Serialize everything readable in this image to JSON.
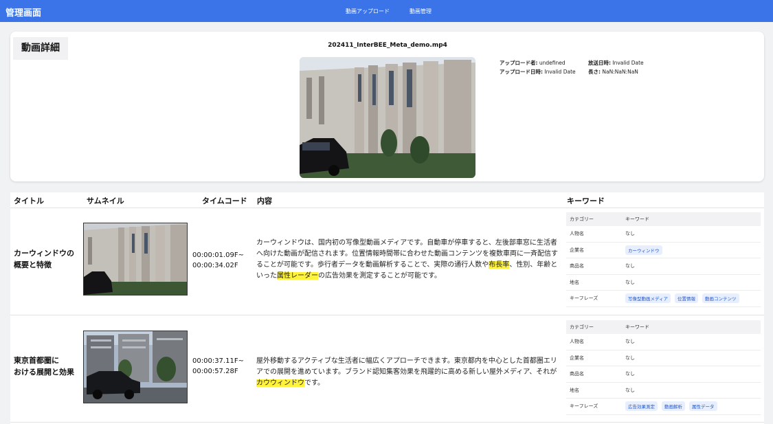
{
  "header": {
    "brand": "管理画面",
    "nav": [
      "動画アップロード",
      "動画管理"
    ],
    "color": "#3b73e8"
  },
  "detail": {
    "section_title": "動画詳細",
    "file_name": "202411_InterBEE_Meta_demo.mp4",
    "meta": {
      "uploader_label": "アップロード者:",
      "uploader_value": "undefined",
      "upload_date_label": "アップロード日時:",
      "upload_date_value": "Invalid Date",
      "broadcast_label": "放送日時:",
      "broadcast_value": "Invalid Date",
      "length_label": "長さ:",
      "length_value": "NaN:NaN:NaN"
    }
  },
  "table": {
    "headers": [
      "タイトル",
      "サムネイル",
      "タイムコード",
      "内容",
      "キーワード"
    ],
    "rows": [
      {
        "title_line1": "カーウィンドウの",
        "title_line2": "概要と特徴",
        "tc_start": "00:00:01.09F~",
        "tc_end": "00:00:34.02F",
        "content": {
          "before_1": "カーウィンドウは、国内初の写像型動画メディアです。自動車が停車すると、左後部車窓に生活者へ向けた動画が配信されます。位置情報時間帯に合わせた動画コンテンツを複数車両に一斉配信することが可能です。歩行者データを動画解析することで、実際の通行人数や",
          "hl_1": "布長率",
          "between": "、性別、年齢といった",
          "hl_2": "属性レーダー",
          "after": "の広告効果を測定することが可能です。"
        },
        "keywords": {
          "head_category": "カテゴリー",
          "head_keyword": "キーワード",
          "rows": [
            {
              "category": "人物名",
              "values": [
                "なし"
              ],
              "chips": false
            },
            {
              "category": "企業名",
              "values": [
                "カーウィンドウ"
              ],
              "chips": true
            },
            {
              "category": "商品名",
              "values": [
                "なし"
              ],
              "chips": false
            },
            {
              "category": "地名",
              "values": [
                "なし"
              ],
              "chips": false
            },
            {
              "category": "キーフレーズ",
              "values": [
                "写像型動画メディア",
                "位置情報",
                "動画コンテンツ"
              ],
              "chips": true
            }
          ]
        }
      },
      {
        "title_line1": "東京首都圏に",
        "title_line2": "おける展開と効果",
        "tc_start": "00:00:37.11F~",
        "tc_end": "00:00:57.28F",
        "content": {
          "before_1": "屋外移動するアクティブな生活者に幅広くアプローチできます。東京都内を中心とした首都圏エリアでの展開を進めています。ブランド認知集客効果を飛躍的に高める新しい屋外メディア、それが",
          "hl_1": "カウウィンドウ",
          "between": "です。",
          "hl_2": "",
          "after": ""
        },
        "keywords": {
          "head_category": "カテゴリー",
          "head_keyword": "キーワード",
          "rows": [
            {
              "category": "人物名",
              "values": [
                "なし"
              ],
              "chips": false
            },
            {
              "category": "企業名",
              "values": [
                "なし"
              ],
              "chips": false
            },
            {
              "category": "商品名",
              "values": [
                "なし"
              ],
              "chips": false
            },
            {
              "category": "地名",
              "values": [
                "なし"
              ],
              "chips": false
            },
            {
              "category": "キーフレーズ",
              "values": [
                "広告効果測定",
                "動画解析",
                "属性データ"
              ],
              "chips": true
            }
          ]
        }
      }
    ]
  }
}
